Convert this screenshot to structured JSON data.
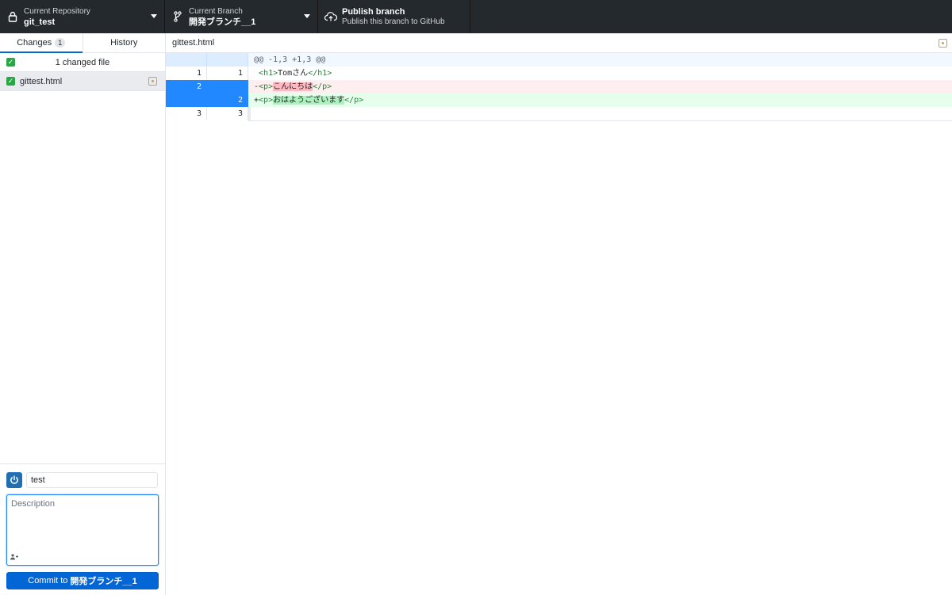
{
  "toolbar": {
    "repo": {
      "label": "Current Repository",
      "name": "git_test",
      "icon": "lock-icon"
    },
    "branch": {
      "label": "Current Branch",
      "name": "開発ブランチ__1",
      "icon": "git-branch-icon"
    },
    "publish": {
      "title": "Publish branch",
      "subtitle": "Publish this branch to GitHub",
      "icon": "cloud-upload-icon"
    }
  },
  "sidebar": {
    "tabs": [
      {
        "label": "Changes",
        "count": "1",
        "active": true
      },
      {
        "label": "History",
        "active": false
      }
    ],
    "changes_header": "1 changed file",
    "files": [
      {
        "name": "gittest.html",
        "status": "modified",
        "checked": true
      }
    ]
  },
  "commit": {
    "summary": "test",
    "description_placeholder": "Description",
    "button_prefix": "Commit to",
    "button_branch": "開発ブランチ__1"
  },
  "diff": {
    "filename": "gittest.html",
    "hunk": "@@ -1,3 +1,3 @@",
    "lines": [
      {
        "type": "context",
        "old": "1",
        "new": "1",
        "pre": " ",
        "tag_open": "<h1>",
        "text": "Tomさん",
        "tag_close": "</h1>"
      },
      {
        "type": "delete",
        "old": "2",
        "new": "",
        "pre": "-",
        "tag_open": "<p>",
        "text": "こんにちは",
        "tag_close": "</p>"
      },
      {
        "type": "add",
        "old": "",
        "new": "2",
        "pre": "+",
        "tag_open": "<p>",
        "text": "おはようございます",
        "tag_close": "</p>"
      },
      {
        "type": "context",
        "old": "3",
        "new": "3",
        "pre": "",
        "tag_open": "",
        "text": "",
        "tag_close": ""
      }
    ]
  },
  "colors": {
    "toolbar_bg": "#24292e",
    "accent": "#0366d6",
    "added_bg": "#e6ffed",
    "deleted_bg": "#ffeef0",
    "modified": "#d4a72c",
    "checked": "#28a745"
  }
}
